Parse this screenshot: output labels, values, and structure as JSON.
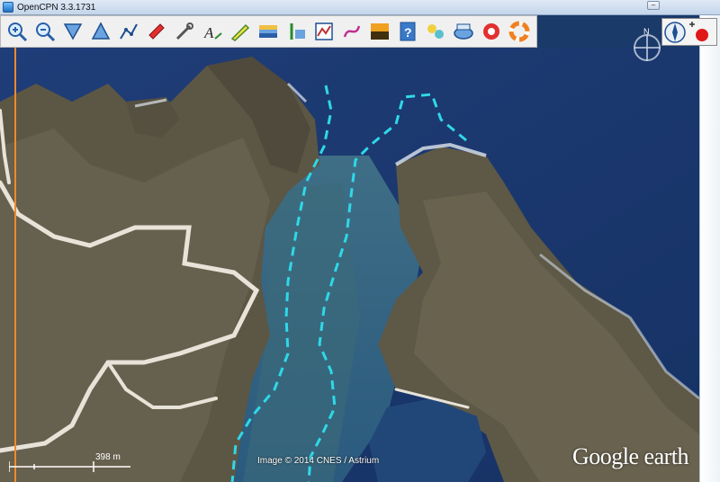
{
  "window": {
    "title": "OpenCPN 3.3.1731",
    "minimize_label": "–"
  },
  "toolbar": {
    "tools": [
      {
        "name": "zoom-in-icon"
      },
      {
        "name": "zoom-out-icon"
      },
      {
        "name": "scale-down-icon"
      },
      {
        "name": "scale-up-icon"
      },
      {
        "name": "create-route-icon"
      },
      {
        "name": "auto-follow-icon"
      },
      {
        "name": "settings-icon"
      },
      {
        "name": "text-tool-icon"
      },
      {
        "name": "current-icon"
      },
      {
        "name": "layers-icon"
      },
      {
        "name": "tide-icon"
      },
      {
        "name": "route-manager-icon"
      },
      {
        "name": "track-icon"
      },
      {
        "name": "color-scheme-icon"
      },
      {
        "name": "help-icon"
      },
      {
        "name": "ais-icon"
      },
      {
        "name": "chart-quilting-icon"
      },
      {
        "name": "mob-icon"
      },
      {
        "name": "lifebuoy-icon"
      }
    ]
  },
  "compass": {
    "north_label": "N"
  },
  "map": {
    "scale_label": "398 m",
    "attribution": "Image © 2014 CNES / Astrium",
    "watermark": "Google earth",
    "route_color": "#2fd8e8"
  }
}
